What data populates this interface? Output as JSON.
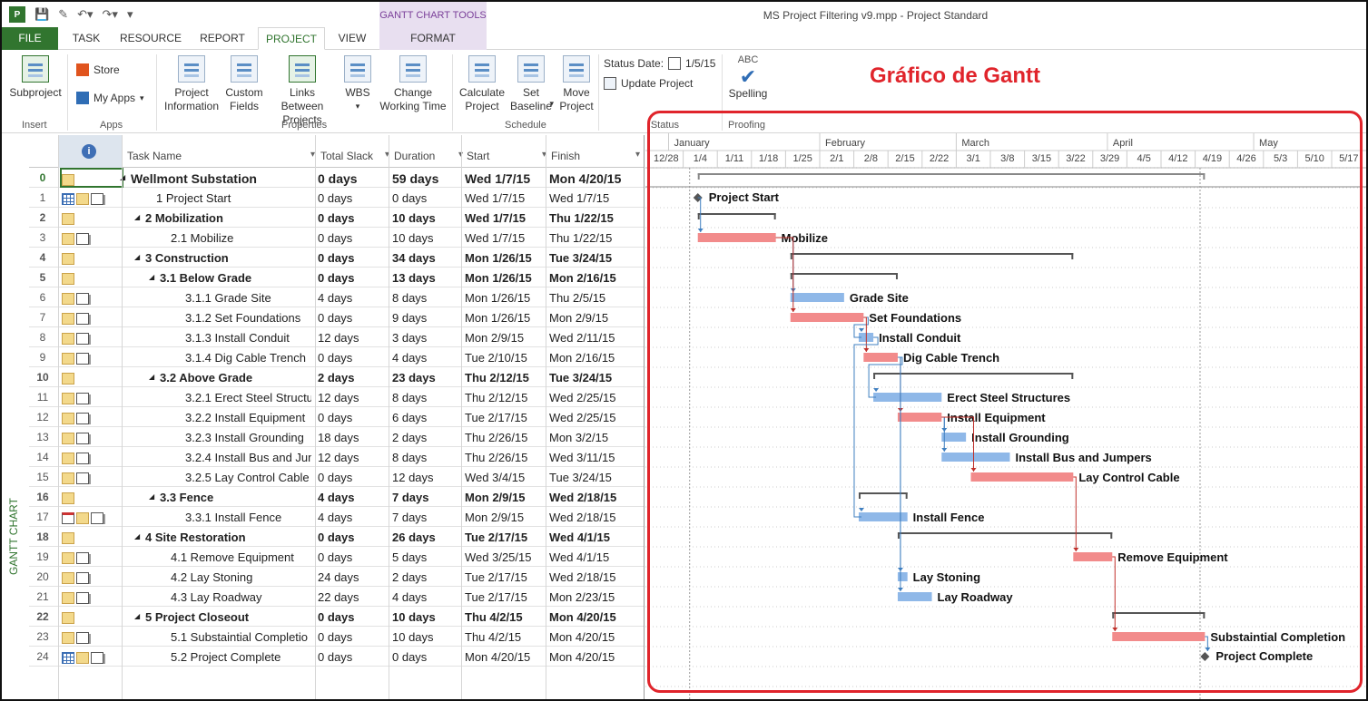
{
  "window": {
    "title": "MS Project Filtering v9.mpp - Project Standard",
    "tools_tab": "GANTT CHART TOOLS"
  },
  "tabs": [
    "FILE",
    "TASK",
    "RESOURCE",
    "REPORT",
    "PROJECT",
    "VIEW",
    "FORMAT"
  ],
  "ribbon": {
    "subproject": "Subproject",
    "store": "Store",
    "my_apps": "My Apps",
    "project_information": "Project Information",
    "custom_fields": "Custom Fields",
    "links_between_projects": "Links Between Projects",
    "wbs": "WBS",
    "change_working_time": "Change Working Time",
    "calculate_project": "Calculate Project",
    "set_baseline": "Set Baseline",
    "move_project": "Move Project",
    "status_date_label": "Status Date:",
    "status_date_value": "1/5/15",
    "update_project": "Update Project",
    "spelling": "Spelling",
    "abc": "ABC",
    "groups": {
      "insert": "Insert",
      "apps": "Apps",
      "properties": "Properties",
      "schedule": "Schedule",
      "status": "Status",
      "proofing": "Proofing"
    }
  },
  "annotation": "Gráfico de Gantt",
  "view_label": "GANTT CHART",
  "columns": {
    "task_name": "Task Name",
    "total_slack": "Total Slack",
    "duration": "Duration",
    "start": "Start",
    "finish": "Finish"
  },
  "rows": [
    {
      "id": "0",
      "name": "Wellmont Substation",
      "slack": "0 days",
      "dur": "59 days",
      "start": "Wed 1/7/15",
      "finish": "Mon 4/20/15",
      "level": 0,
      "summary": true,
      "icons": [
        "note"
      ]
    },
    {
      "id": "1",
      "name": "1 Project Start",
      "slack": "0 days",
      "dur": "0 days",
      "start": "Wed 1/7/15",
      "finish": "Wed 1/7/15",
      "level": 1,
      "summary": false,
      "icons": [
        "tbl",
        "note",
        "res"
      ]
    },
    {
      "id": "2",
      "name": "2 Mobilization",
      "slack": "0 days",
      "dur": "10 days",
      "start": "Wed 1/7/15",
      "finish": "Thu 1/22/15",
      "level": 1,
      "summary": true,
      "icons": [
        "note"
      ]
    },
    {
      "id": "3",
      "name": "2.1 Mobilize",
      "slack": "0 days",
      "dur": "10 days",
      "start": "Wed 1/7/15",
      "finish": "Thu 1/22/15",
      "level": 2,
      "summary": false,
      "icons": [
        "note",
        "res"
      ]
    },
    {
      "id": "4",
      "name": "3 Construction",
      "slack": "0 days",
      "dur": "34 days",
      "start": "Mon 1/26/15",
      "finish": "Tue 3/24/15",
      "level": 1,
      "summary": true,
      "icons": [
        "note"
      ]
    },
    {
      "id": "5",
      "name": "3.1 Below Grade",
      "slack": "0 days",
      "dur": "13 days",
      "start": "Mon 1/26/15",
      "finish": "Mon 2/16/15",
      "level": 2,
      "summary": true,
      "icons": [
        "note"
      ]
    },
    {
      "id": "6",
      "name": "3.1.1 Grade Site",
      "slack": "4 days",
      "dur": "8 days",
      "start": "Mon 1/26/15",
      "finish": "Thu 2/5/15",
      "level": 3,
      "summary": false,
      "icons": [
        "note",
        "res"
      ]
    },
    {
      "id": "7",
      "name": "3.1.2 Set Foundations",
      "slack": "0 days",
      "dur": "9 days",
      "start": "Mon 1/26/15",
      "finish": "Mon 2/9/15",
      "level": 3,
      "summary": false,
      "icons": [
        "note",
        "res"
      ]
    },
    {
      "id": "8",
      "name": "3.1.3 Install Conduit",
      "slack": "12 days",
      "dur": "3 days",
      "start": "Mon 2/9/15",
      "finish": "Wed 2/11/15",
      "level": 3,
      "summary": false,
      "icons": [
        "note",
        "res"
      ]
    },
    {
      "id": "9",
      "name": "3.1.4 Dig Cable Trench",
      "slack": "0 days",
      "dur": "4 days",
      "start": "Tue 2/10/15",
      "finish": "Mon 2/16/15",
      "level": 3,
      "summary": false,
      "icons": [
        "note",
        "res"
      ]
    },
    {
      "id": "10",
      "name": "3.2 Above Grade",
      "slack": "2 days",
      "dur": "23 days",
      "start": "Thu 2/12/15",
      "finish": "Tue 3/24/15",
      "level": 2,
      "summary": true,
      "icons": [
        "note"
      ]
    },
    {
      "id": "11",
      "name": "3.2.1 Erect Steel Structu",
      "slack": "12 days",
      "dur": "8 days",
      "start": "Thu 2/12/15",
      "finish": "Wed 2/25/15",
      "level": 3,
      "summary": false,
      "icons": [
        "note",
        "res"
      ]
    },
    {
      "id": "12",
      "name": "3.2.2 Install Equipment",
      "slack": "0 days",
      "dur": "6 days",
      "start": "Tue 2/17/15",
      "finish": "Wed 2/25/15",
      "level": 3,
      "summary": false,
      "icons": [
        "note",
        "res"
      ]
    },
    {
      "id": "13",
      "name": "3.2.3 Install Grounding",
      "slack": "18 days",
      "dur": "2 days",
      "start": "Thu 2/26/15",
      "finish": "Mon 3/2/15",
      "level": 3,
      "summary": false,
      "icons": [
        "note",
        "res"
      ]
    },
    {
      "id": "14",
      "name": "3.2.4 Install Bus and Jum",
      "slack": "12 days",
      "dur": "8 days",
      "start": "Thu 2/26/15",
      "finish": "Wed 3/11/15",
      "level": 3,
      "summary": false,
      "icons": [
        "note",
        "res"
      ]
    },
    {
      "id": "15",
      "name": "3.2.5 Lay Control Cable",
      "slack": "0 days",
      "dur": "12 days",
      "start": "Wed 3/4/15",
      "finish": "Tue 3/24/15",
      "level": 3,
      "summary": false,
      "icons": [
        "note",
        "res"
      ]
    },
    {
      "id": "16",
      "name": "3.3 Fence",
      "slack": "4 days",
      "dur": "7 days",
      "start": "Mon 2/9/15",
      "finish": "Wed 2/18/15",
      "level": 2,
      "summary": true,
      "icons": [
        "note"
      ]
    },
    {
      "id": "17",
      "name": "3.3.1 Install Fence",
      "slack": "4 days",
      "dur": "7 days",
      "start": "Mon 2/9/15",
      "finish": "Wed 2/18/15",
      "level": 3,
      "summary": false,
      "icons": [
        "cal",
        "note",
        "res"
      ]
    },
    {
      "id": "18",
      "name": "4 Site Restoration",
      "slack": "0 days",
      "dur": "26 days",
      "start": "Tue 2/17/15",
      "finish": "Wed 4/1/15",
      "level": 1,
      "summary": true,
      "icons": [
        "note"
      ]
    },
    {
      "id": "19",
      "name": "4.1 Remove Equipment",
      "slack": "0 days",
      "dur": "5 days",
      "start": "Wed 3/25/15",
      "finish": "Wed 4/1/15",
      "level": 2,
      "summary": false,
      "icons": [
        "note",
        "res"
      ]
    },
    {
      "id": "20",
      "name": "4.2 Lay Stoning",
      "slack": "24 days",
      "dur": "2 days",
      "start": "Tue 2/17/15",
      "finish": "Wed 2/18/15",
      "level": 2,
      "summary": false,
      "icons": [
        "note",
        "res"
      ]
    },
    {
      "id": "21",
      "name": "4.3 Lay Roadway",
      "slack": "22 days",
      "dur": "4 days",
      "start": "Tue 2/17/15",
      "finish": "Mon 2/23/15",
      "level": 2,
      "summary": false,
      "icons": [
        "note",
        "res"
      ]
    },
    {
      "id": "22",
      "name": "5 Project Closeout",
      "slack": "0 days",
      "dur": "10 days",
      "start": "Thu 4/2/15",
      "finish": "Mon 4/20/15",
      "level": 1,
      "summary": true,
      "icons": [
        "note"
      ]
    },
    {
      "id": "23",
      "name": "5.1 Substaintial Completio",
      "slack": "0 days",
      "dur": "10 days",
      "start": "Thu 4/2/15",
      "finish": "Mon 4/20/15",
      "level": 2,
      "summary": false,
      "icons": [
        "note",
        "res"
      ]
    },
    {
      "id": "24",
      "name": "5.2 Project Complete",
      "slack": "0 days",
      "dur": "0 days",
      "start": "Mon 4/20/15",
      "finish": "Mon 4/20/15",
      "level": 2,
      "summary": false,
      "icons": [
        "tbl",
        "note",
        "res"
      ]
    }
  ],
  "timescale": {
    "months": [
      {
        "label": "January",
        "start": "2015-01-01"
      },
      {
        "label": "February",
        "start": "2015-02-01"
      },
      {
        "label": "March",
        "start": "2015-03-01"
      },
      {
        "label": "April",
        "start": "2015-04-01"
      },
      {
        "label": "May",
        "start": "2015-05-01"
      }
    ],
    "weeks": [
      "12/28",
      "1/4",
      "1/11",
      "1/18",
      "1/25",
      "2/1",
      "2/8",
      "2/15",
      "2/22",
      "3/1",
      "3/8",
      "3/15",
      "3/22",
      "3/29",
      "4/5",
      "4/12",
      "4/19",
      "4/26",
      "5/3",
      "5/10",
      "5/17"
    ]
  },
  "colors": {
    "critical": "#f28b8b",
    "normal": "#8fb8e8",
    "summary": "#555555",
    "link_critical": "#c0302a",
    "link_normal": "#3f7fc0",
    "annotation": "#e0242b",
    "file_tab": "#31752f"
  },
  "chart_data": {
    "type": "gantt",
    "tasks": [
      {
        "row": 0,
        "label": "",
        "start": "2015-01-07",
        "finish": "2015-04-20",
        "kind": "summary",
        "critical": false
      },
      {
        "row": 1,
        "label": "Project Start",
        "start": "2015-01-07",
        "finish": "2015-01-07",
        "kind": "milestone",
        "critical": false
      },
      {
        "row": 2,
        "label": "",
        "start": "2015-01-07",
        "finish": "2015-01-22",
        "kind": "summary",
        "critical": false
      },
      {
        "row": 3,
        "label": "Mobilize",
        "start": "2015-01-07",
        "finish": "2015-01-22",
        "kind": "task",
        "critical": true
      },
      {
        "row": 4,
        "label": "",
        "start": "2015-01-26",
        "finish": "2015-03-24",
        "kind": "summary",
        "critical": false
      },
      {
        "row": 5,
        "label": "",
        "start": "2015-01-26",
        "finish": "2015-02-16",
        "kind": "summary",
        "critical": false
      },
      {
        "row": 6,
        "label": "Grade Site",
        "start": "2015-01-26",
        "finish": "2015-02-05",
        "kind": "task",
        "critical": false
      },
      {
        "row": 7,
        "label": "Set Foundations",
        "start": "2015-01-26",
        "finish": "2015-02-09",
        "kind": "task",
        "critical": true
      },
      {
        "row": 8,
        "label": "Install Conduit",
        "start": "2015-02-09",
        "finish": "2015-02-11",
        "kind": "task",
        "critical": false
      },
      {
        "row": 9,
        "label": "Dig Cable Trench",
        "start": "2015-02-10",
        "finish": "2015-02-16",
        "kind": "task",
        "critical": true
      },
      {
        "row": 10,
        "label": "",
        "start": "2015-02-12",
        "finish": "2015-03-24",
        "kind": "summary",
        "critical": false
      },
      {
        "row": 11,
        "label": "Erect Steel Structures",
        "start": "2015-02-12",
        "finish": "2015-02-25",
        "kind": "task",
        "critical": false
      },
      {
        "row": 12,
        "label": "Install Equipment",
        "start": "2015-02-17",
        "finish": "2015-02-25",
        "kind": "task",
        "critical": true
      },
      {
        "row": 13,
        "label": "Install Grounding",
        "start": "2015-02-26",
        "finish": "2015-03-02",
        "kind": "task",
        "critical": false
      },
      {
        "row": 14,
        "label": "Install Bus and Jumpers",
        "start": "2015-02-26",
        "finish": "2015-03-11",
        "kind": "task",
        "critical": false
      },
      {
        "row": 15,
        "label": "Lay Control Cable",
        "start": "2015-03-04",
        "finish": "2015-03-24",
        "kind": "task",
        "critical": true
      },
      {
        "row": 16,
        "label": "",
        "start": "2015-02-09",
        "finish": "2015-02-18",
        "kind": "summary",
        "critical": false
      },
      {
        "row": 17,
        "label": "Install Fence",
        "start": "2015-02-09",
        "finish": "2015-02-18",
        "kind": "task",
        "critical": false
      },
      {
        "row": 18,
        "label": "",
        "start": "2015-02-17",
        "finish": "2015-04-01",
        "kind": "summary",
        "critical": false
      },
      {
        "row": 19,
        "label": "Remove Equipment",
        "start": "2015-03-25",
        "finish": "2015-04-01",
        "kind": "task",
        "critical": true
      },
      {
        "row": 20,
        "label": "Lay Stoning",
        "start": "2015-02-17",
        "finish": "2015-02-18",
        "kind": "task",
        "critical": false
      },
      {
        "row": 21,
        "label": "Lay Roadway",
        "start": "2015-02-17",
        "finish": "2015-02-23",
        "kind": "task",
        "critical": false
      },
      {
        "row": 22,
        "label": "",
        "start": "2015-04-02",
        "finish": "2015-04-20",
        "kind": "summary",
        "critical": false
      },
      {
        "row": 23,
        "label": "Substaintial Completion",
        "start": "2015-04-02",
        "finish": "2015-04-20",
        "kind": "task",
        "critical": true
      },
      {
        "row": 24,
        "label": "Project Complete",
        "start": "2015-04-20",
        "finish": "2015-04-20",
        "kind": "milestone",
        "critical": false
      }
    ],
    "links": [
      [
        1,
        3
      ],
      [
        3,
        6
      ],
      [
        3,
        7
      ],
      [
        7,
        8
      ],
      [
        7,
        9
      ],
      [
        9,
        11
      ],
      [
        9,
        12
      ],
      [
        12,
        13
      ],
      [
        12,
        14
      ],
      [
        12,
        15
      ],
      [
        8,
        17
      ],
      [
        9,
        20
      ],
      [
        9,
        21
      ],
      [
        15,
        19
      ],
      [
        19,
        23
      ],
      [
        23,
        24
      ]
    ]
  }
}
